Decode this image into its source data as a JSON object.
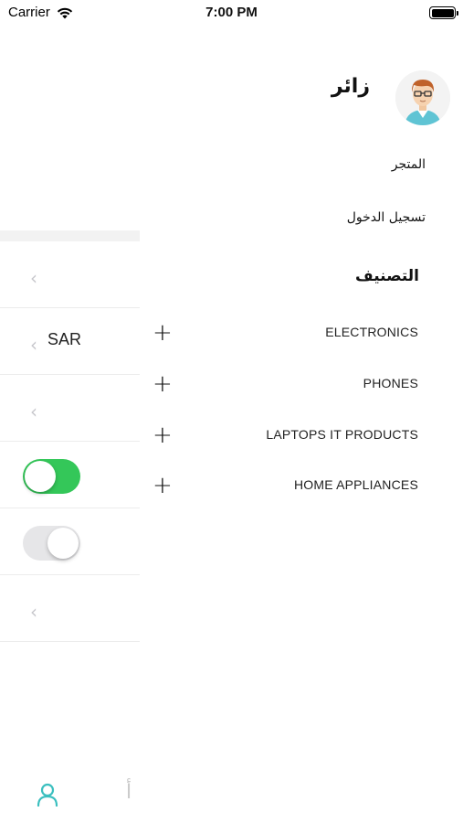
{
  "status_bar": {
    "carrier": "Carrier",
    "time": "7:00 PM",
    "wifi_icon": "wifi-icon",
    "battery_icon": "battery-icon",
    "battery_level": 1.0
  },
  "settings": {
    "rows": [
      {
        "type": "chevron"
      },
      {
        "type": "currency",
        "value": "SAR"
      },
      {
        "type": "chevron"
      },
      {
        "type": "toggle",
        "on": true
      },
      {
        "type": "toggle",
        "on": false
      },
      {
        "type": "chevron"
      }
    ],
    "chevron_glyph": "‹",
    "toggle_on_color": "#34c759"
  },
  "drawer": {
    "username": "زائر",
    "menu": {
      "store": "المتجر",
      "login": "تسجيل الدخول"
    },
    "categories_title": "التصنيف",
    "expand_glyph": "+",
    "categories": [
      "ELECTRONICS",
      "PHONES",
      "LAPTOPS IT PRODUCTS",
      "HOME APPLIANCES"
    ]
  },
  "tabbar": {
    "user_icon": "user-icon",
    "language_glyph": "أ",
    "active_color": "#3bbfbf"
  }
}
